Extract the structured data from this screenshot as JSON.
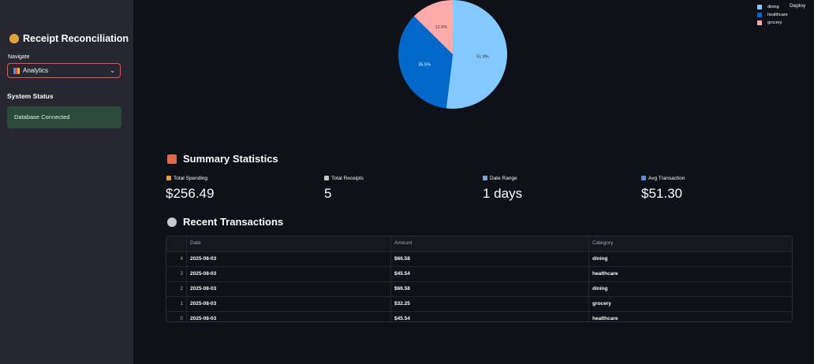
{
  "sidebar": {
    "title": "Receipt Reconciliation",
    "title_icon": "money-bag-icon",
    "nav_label": "Navigate",
    "nav_selected": "Analytics",
    "nav_icon": "bar-chart-icon",
    "status_title": "System Status",
    "status_message": "Database Connected"
  },
  "header": {
    "deploy_label": "Deploy"
  },
  "chart_data": {
    "type": "pie",
    "categories": [
      "dining",
      "healthcare",
      "grocery"
    ],
    "values": [
      51.9,
      35.5,
      12.6
    ],
    "labels": [
      "51.9%",
      "35.5%",
      "12.6%"
    ],
    "colors": [
      "#83c9ff",
      "#0068c9",
      "#ffabab"
    ],
    "legend_position": "top-right"
  },
  "summary": {
    "title": "Summary Statistics",
    "title_icon": "clipboard-icon",
    "metrics": [
      {
        "label": "Total Spending",
        "value": "$256.49",
        "icon": "money-bag-icon",
        "color": "#e0a03a"
      },
      {
        "label": "Total Receipts",
        "value": "5",
        "icon": "document-icon",
        "color": "#c9c9c9"
      },
      {
        "label": "Date Range",
        "value": "1 days",
        "icon": "calendar-icon",
        "color": "#7aa2d6"
      },
      {
        "label": "Avg Transaction",
        "value": "$51.30",
        "icon": "credit-card-icon",
        "color": "#5b8fd0"
      }
    ]
  },
  "transactions": {
    "title": "Recent Transactions",
    "title_icon": "clock-icon",
    "columns": [
      "",
      "Date",
      "Amount",
      "Category"
    ],
    "rows": [
      {
        "index": "4",
        "date": "2025-08-03",
        "amount": "$66.58",
        "category": "dining"
      },
      {
        "index": "3",
        "date": "2025-08-03",
        "amount": "$45.54",
        "category": "healthcare"
      },
      {
        "index": "2",
        "date": "2025-08-03",
        "amount": "$66.58",
        "category": "dining"
      },
      {
        "index": "1",
        "date": "2025-08-03",
        "amount": "$32.25",
        "category": "grocery"
      },
      {
        "index": "0",
        "date": "2025-08-03",
        "amount": "$45.54",
        "category": "healthcare"
      }
    ]
  }
}
